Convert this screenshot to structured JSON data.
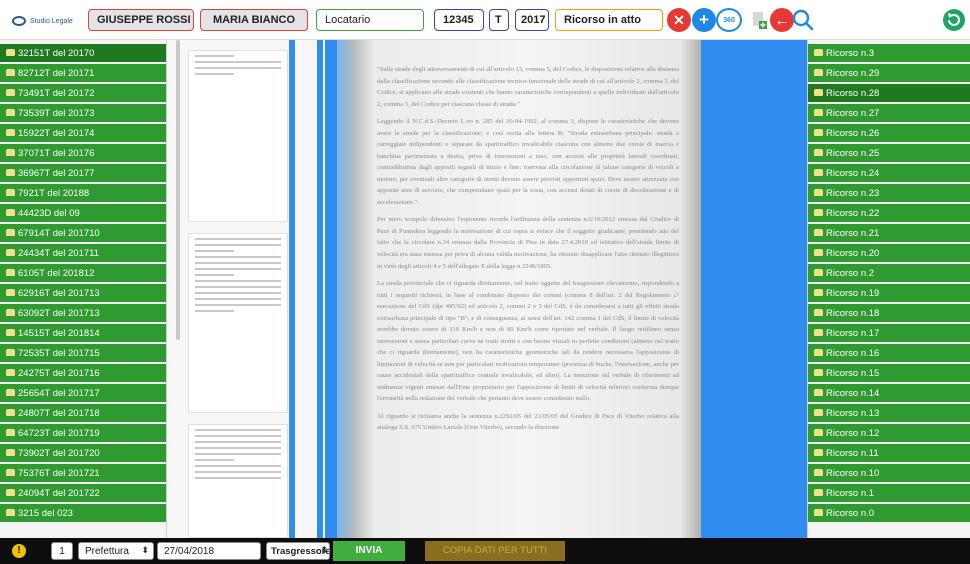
{
  "topbar": {
    "logo_text": "Studio Legale",
    "fields": [
      {
        "value": "GIUSEPPE ROSSI",
        "border": "#e04040"
      },
      {
        "value": "MARIA BIANCO",
        "border": "#e04040"
      },
      {
        "value": "Locatario",
        "border": "#43a047"
      },
      {
        "value": "12345",
        "border": "#3949ab"
      },
      {
        "value": "T",
        "border": "#3949ab"
      },
      {
        "value": "2017",
        "border": "#3949ab"
      },
      {
        "value": "Ricorso in atto",
        "border": "#f59e0b"
      }
    ],
    "icons": [
      "close-circle-icon",
      "add-circle-icon",
      "rotate-360-icon",
      "add-file-icon",
      "back-arrow-icon",
      "search-icon",
      "refresh-icon"
    ],
    "icon_360_label": "360"
  },
  "left_list": [
    "32151T del 20170",
    "82712T del 20171",
    "73491T del 20172",
    "73539T del 20173",
    "15922T del 20174",
    "37071T del 20176",
    "36967T del 20177",
    "7921T del 20188",
    "44423D del 09",
    "67914T del 201710",
    "24434T del 201711",
    "6105T del 201812",
    "62916T del 201713",
    "63092T del 201713",
    "14515T del 201814",
    "72535T del 201715",
    "24275T del 201716",
    "25654T del 201717",
    "24807T del 201718",
    "64723T del 201719",
    "73902T del 201720",
    "75376T del 201721",
    "24094T del 201722",
    "3215 del 023"
  ],
  "right_list": [
    "Ricorso n.3",
    "Ricorso n.29",
    "Ricorso n.28",
    "Ricorso n.27",
    "Ricorso n.26",
    "Ricorso n.25",
    "Ricorso n.24",
    "Ricorso n.23",
    "Ricorso n.22",
    "Ricorso n.21",
    "Ricorso n.20",
    "Ricorso n.2",
    "Ricorso n.19",
    "Ricorso n.18",
    "Ricorso n.17",
    "Ricorso n.16",
    "Ricorso n.15",
    "Ricorso n.14",
    "Ricorso n.13",
    "Ricorso n.12",
    "Ricorso n.11",
    "Ricorso n.10",
    "Ricorso n.1",
    "Ricorso n.0"
  ],
  "document": {
    "paragraphs": [
      "\"Sulle strade degli attraversamenti di cui all'articolo 13, comma 5, del Codice, le disposizioni relative alla distanza dalla classificazione secondo alle classificazione tecnico-funzionale delle strade di cui all'articolo 2, comma 3, del Codice, si applicano alle strade esistenti che hanno caratteristiche corrispondenti a quelle individuate dall'articolo 2, comma 3, del Codice per ciascuna classe di strada.\"",
      "Leggendo il N.C.d.S.-Decreto L.vo n. 285 del 30-04-1992, al comma 3, dispone le caratteristiche che devono avere le strade per la classificazione; e così recita alla lettera B: \"Strada extraurbana principale: strada a carreggiate indipendenti o separate da spartitraffico invalicabile ciascuna con almeno due corsie di marcia e banchina pavimentata a destra, priva di intersezioni a raso, con accessi alle proprietà laterali coordinati, contraddistinta dagli appositi segnali di inizio e fine; riservata alla circolazione di talune categorie di veicoli a motore; per eventuali altre categorie di utenti devono essere previsti opportuni spazi. Deve essere attrezzata con apposite aree di servizio, che comprendano spazi per la sosta, con accessi dotati di corsie di decelerazione e di accelerazione.\"",
      "Per mero scrupolo difensivo l'esponente ricorda l'ordinanza della sentenza n.6/19/2012 emessa dal Giudice di Pace di Pontedera leggendo la motivazione di cui sopra si evince che il soggetto giudicante, prendendo atto del fatto che la circolare n.34 emessa dalla Provincia di Pisa in data 27.4.2010 ed istitutiva dell'strada limite di velocità era stata emessa per priva di alcuna valida motivazione, ha ritenuto disapplicare l'atto ritenuto illegittimo in virtù degli articoli 4 e 5 dell'allegato E della legge n.2248/1865.",
      "La strada provinciale che ci riguarda direttamente, nel tratto oggetto del trasgressore rilevamento, rispondendo a tutti i requisiti richiesti, in base al combinato disposto dei commi (comma 8 dell'art. 2 del Regolamento di esecuzione del CdS (dpr 495/92) ed articolo 2, commi 2 e 3 del CdS, è da considerarsi a tutti gli effetti strada extraurbana principale di tipo \"B\"; e di conseguenza, ai sensi dell'art. 142 comma 1 del CdS, il limite di velocità avrebbe dovuto essere di 110 Km/h e non di 80 Km/h come riportato nel verbale. Il luogo rettilineo senza intersezioni e senza particolari curve né tratti stretti e con buone visuali in perfette condizioni (almeno nel tratto che ci riguarda direttamente), non ha caratteristiche geometriche tali da rendere necessaria l'apposizione di limitazioni di velocità se non per particolari motivazioni temporanee (presenza di buche, l'intersezione, anche per cause accidentali della spartitraffico centrale invalicabile, ed altro). La menzione sul verbale di riferimenti ad ordinanze vigenti emesse dall'Ente proprietario per l'apposizione di limiti di velocità inferiori conferma dunque l'erroneità nella redazione del verbale che pertanto deve essere considerato nullo.",
      "Al riguardo si richiama anche la sentenza n.2292/05 del 21/05/05 del Giudice di Pace di Viterbo relativa alla analoga S.S. 675 Umbro Laziale (Orte Viterbo), secondo la direzione"
    ]
  },
  "bottombar": {
    "counter": "1",
    "select1": "Prefettura",
    "date": "27/04/2018",
    "select2": "Trasgressore",
    "send_label": "INVIA",
    "copy_all_label": "COPIA DATI PER TUTTI",
    "warn_symbol": "!",
    "colors": {
      "send": "#3fae3f",
      "copy_all": "#8a6d1f"
    }
  }
}
